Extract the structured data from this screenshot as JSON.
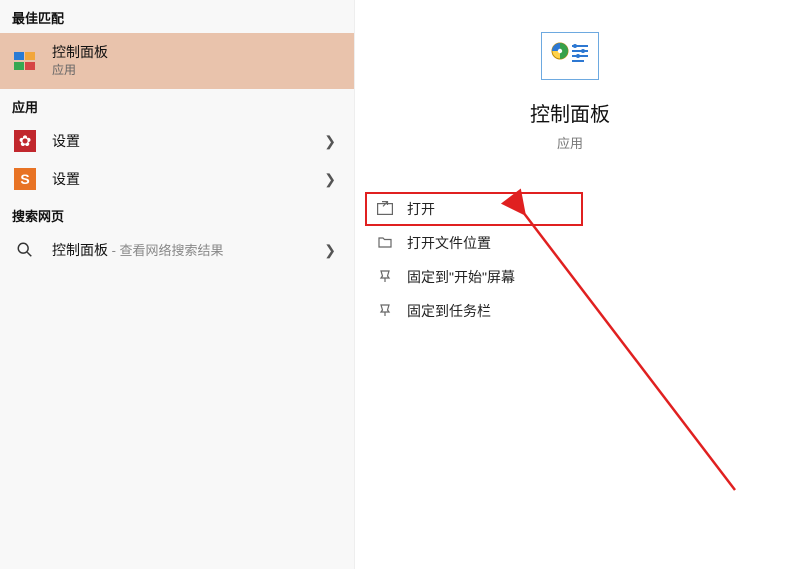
{
  "left": {
    "sections": {
      "best_match": "最佳匹配",
      "apps": "应用",
      "web": "搜索网页"
    },
    "best_match": {
      "title": "控制面板",
      "subtitle": "应用"
    },
    "app_items": [
      {
        "label": "设置"
      },
      {
        "label": "设置"
      }
    ],
    "web_item": {
      "prefix": "控制面板",
      "suffix": " - 查看网络搜索结果"
    }
  },
  "right": {
    "title": "控制面板",
    "subtitle": "应用",
    "actions": [
      {
        "label": "打开"
      },
      {
        "label": "打开文件位置"
      },
      {
        "label": "固定到\"开始\"屏幕"
      },
      {
        "label": "固定到任务栏"
      }
    ]
  }
}
